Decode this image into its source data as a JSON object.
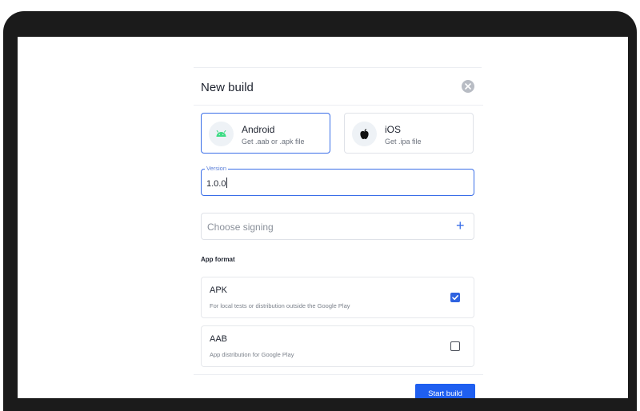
{
  "dialog": {
    "title": "New build",
    "close_icon": "close-icon"
  },
  "platforms": [
    {
      "name": "Android",
      "subtitle": "Get .aab or .apk file",
      "icon": "android-icon",
      "selected": true,
      "color": "#3ddc84"
    },
    {
      "name": "iOS",
      "subtitle": "Get .ipa file",
      "icon": "apple-icon",
      "selected": false
    }
  ],
  "version": {
    "label": "Version",
    "value": "1.0.0"
  },
  "signing": {
    "placeholder": "Choose signing",
    "add_icon": "plus-icon"
  },
  "app_format": {
    "label": "App format",
    "options": [
      {
        "title": "APK",
        "description": "For local tests or distribution outside the Google Play",
        "checked": true
      },
      {
        "title": "AAB",
        "description": "App distribution for Google Play",
        "checked": false
      }
    ]
  },
  "actions": {
    "start_label": "Start build"
  },
  "colors": {
    "accent": "#3a6ee8",
    "primary_button": "#1f5ff0",
    "device_frame": "#1b1b1b"
  }
}
